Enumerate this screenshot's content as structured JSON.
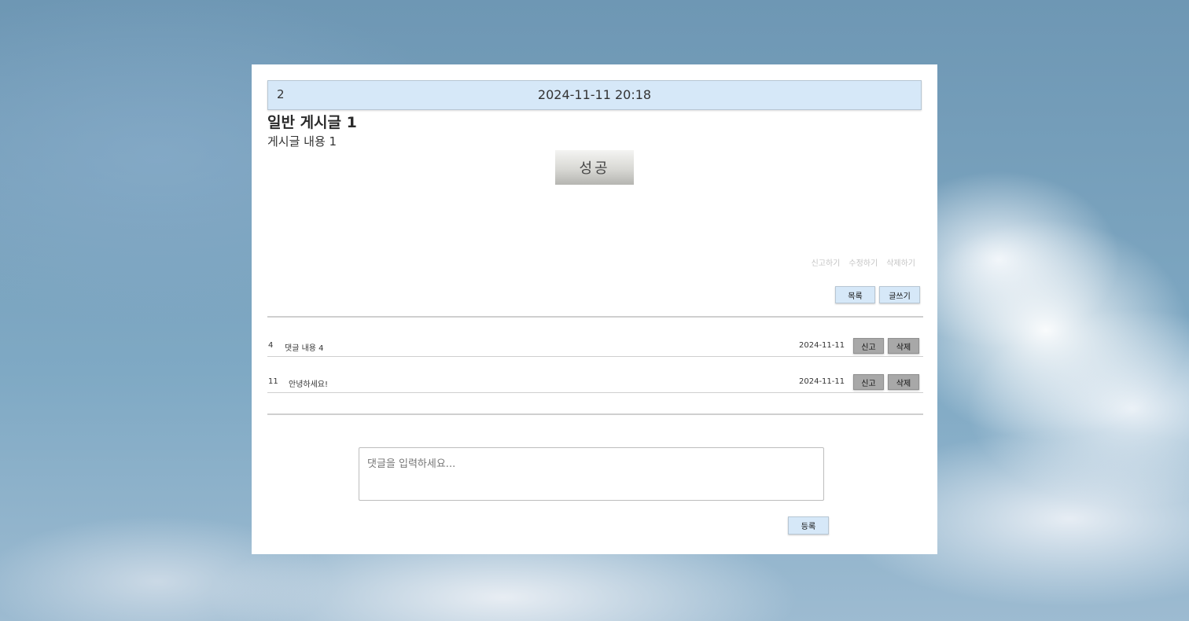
{
  "post": {
    "id": "2",
    "datetime": "2024-11-11 20:18",
    "title": "일반 게시글 1",
    "content": "게시글 내용 1",
    "image_text": "성공"
  },
  "post_actions": {
    "report": "신고하기",
    "edit": "수정하기",
    "delete": "삭제하기"
  },
  "nav_buttons": {
    "list": "목록",
    "write": "글쓰기"
  },
  "comments": [
    {
      "id": "4",
      "text": "댓글 내용 4",
      "date": "2024-11-11",
      "report": "신고",
      "delete": "삭제"
    },
    {
      "id": "11",
      "text": "안녕하세요!",
      "date": "2024-11-11",
      "report": "신고",
      "delete": "삭제"
    }
  ],
  "comment_form": {
    "placeholder": "댓글을 입력하세요...",
    "submit_label": "등록"
  },
  "colors": {
    "header_bar": "#d6e8f8",
    "gray_button": "#a8a8a8",
    "panel": "#ffffff"
  }
}
